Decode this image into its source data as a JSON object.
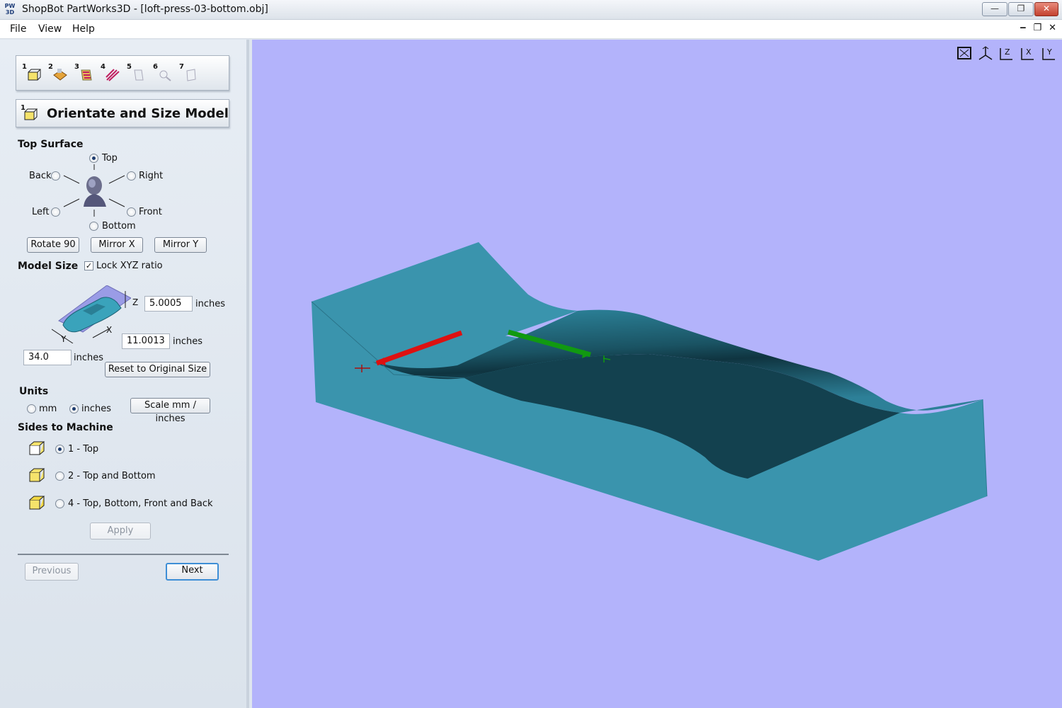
{
  "window": {
    "logo": "PW\n3D",
    "title": "ShopBot PartWorks3D - [loft-press-03-bottom.obj]",
    "min": "—",
    "restore": "❐",
    "close": "✕"
  },
  "menu": {
    "file": "File",
    "view": "View",
    "help": "Help",
    "mdi_min": "‒",
    "mdi_restore": "❐",
    "mdi_close": "✕"
  },
  "steps": [
    "1",
    "2",
    "3",
    "4",
    "5",
    "6",
    "7"
  ],
  "panel": {
    "title": "Orientate and Size Model",
    "title_step": "1",
    "top_surface": {
      "heading": "Top Surface",
      "top": "Top",
      "back": "Back",
      "right": "Right",
      "left": "Left",
      "front": "Front",
      "bottom": "Bottom",
      "selected": "Top"
    },
    "buttons": {
      "rotate": "Rotate 90",
      "mirror_x": "Mirror X",
      "mirror_y": "Mirror Y"
    },
    "model_size": {
      "heading": "Model Size",
      "lock_label": "Lock XYZ ratio",
      "z_value": "5.0005",
      "x_value": "11.0013",
      "y_value": "34.0",
      "unit": "inches",
      "axis_z": "Z",
      "axis_x": "X",
      "axis_y": "Y",
      "reset": "Reset to Original Size"
    },
    "units": {
      "heading": "Units",
      "mm": "mm",
      "inches": "inches",
      "selected": "inches",
      "scale": "Scale mm / inches"
    },
    "sides": {
      "heading": "Sides to Machine",
      "opt1": "1 - Top",
      "opt2": "2 - Top and Bottom",
      "opt4": "4 - Top, Bottom, Front and Back",
      "apply": "Apply"
    },
    "nav": {
      "previous": "Previous",
      "next": "Next"
    }
  },
  "colors": {
    "viewport_bg": "#b3b3fb",
    "model_face": "#3a94ad",
    "x_axis": "#dd1111",
    "y_axis": "#119911"
  }
}
